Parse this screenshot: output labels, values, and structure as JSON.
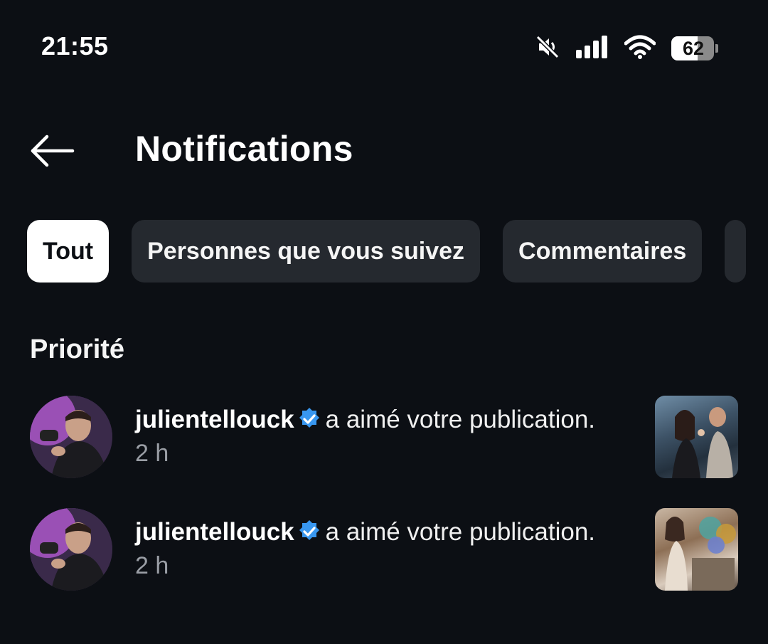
{
  "status_bar": {
    "time": "21:55",
    "battery_level": "62",
    "battery_fraction": 0.62,
    "icons": [
      "mute-icon",
      "signal-icon",
      "wifi-icon",
      "battery-icon"
    ]
  },
  "header": {
    "title": "Notifications",
    "back_icon": "arrow-left-icon"
  },
  "filters": [
    {
      "label": "Tout",
      "active": true
    },
    {
      "label": "Personnes que vous suivez",
      "active": false
    },
    {
      "label": "Commentaires",
      "active": false
    }
  ],
  "section": {
    "title": "Priorité"
  },
  "notifications": [
    {
      "username": "julientellouck",
      "verified": true,
      "action": "a aimé votre publication.",
      "time": "2 h"
    },
    {
      "username": "julientellouck",
      "verified": true,
      "action": "a aimé votre publication.",
      "time": "2 h"
    }
  ],
  "colors": {
    "background": "#0c0f14",
    "chip": "#25292f",
    "chip_active": "#ffffff",
    "verified": "#3897f0",
    "muted_text": "#9a9ea5"
  }
}
